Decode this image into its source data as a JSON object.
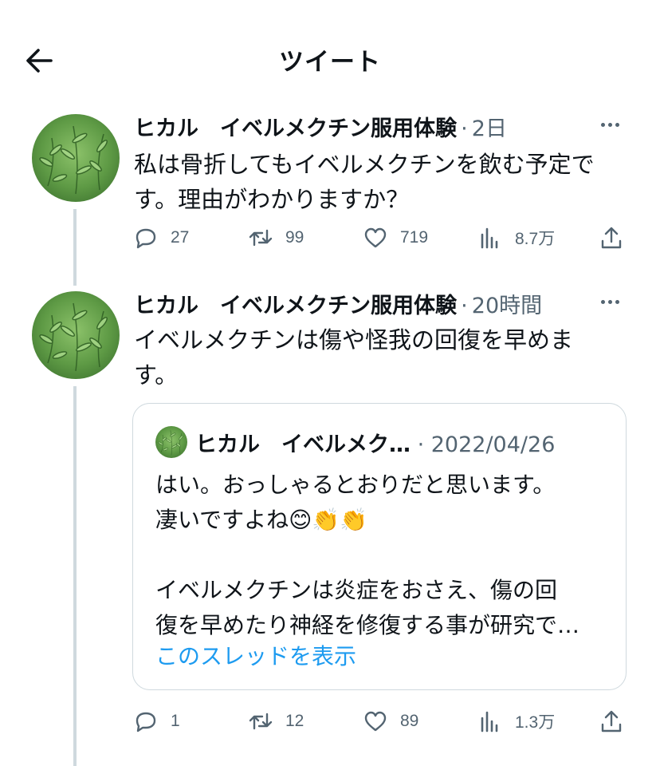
{
  "header": {
    "title": "ツイート"
  },
  "icons": {
    "back": "arrow-left-icon",
    "more": "more-dots-icon",
    "reply": "reply-icon",
    "retweet": "retweet-icon",
    "like": "heart-icon",
    "views": "views-chart-icon",
    "share": "share-icon"
  },
  "colors": {
    "text": "#0f1419",
    "muted": "#536471",
    "link": "#1d9bf0",
    "border": "#cfd9de"
  },
  "tweet1": {
    "author": "ヒカル　イベルメクチン服用体験",
    "sep": "·",
    "time": "2日",
    "text": "私は骨折してもイベルメクチンを飲む予定で\nす。理由がわかりますか？",
    "replies": "27",
    "retweets": "99",
    "likes": "719",
    "views": "8.7万"
  },
  "tweet2": {
    "author": "ヒカル　イベルメクチン服用体験",
    "sep": "·",
    "time": "20時間",
    "text": "イベルメクチンは傷や怪我の回復を早めま\nす。",
    "replies": "1",
    "retweets": "12",
    "likes": "89",
    "views": "1.3万"
  },
  "quote": {
    "author": "ヒカル　イベルメク…",
    "sep": " · ",
    "time": "2022/04/26",
    "text": "はい。おっしゃるとおりだと思います。\n凄いですよね😊👏👏\n\nイベルメクチンは炎症をおさえ、傷の回\n復を早めたり神経を修復する事が研究で…",
    "show_thread": "このスレッドを表示"
  }
}
